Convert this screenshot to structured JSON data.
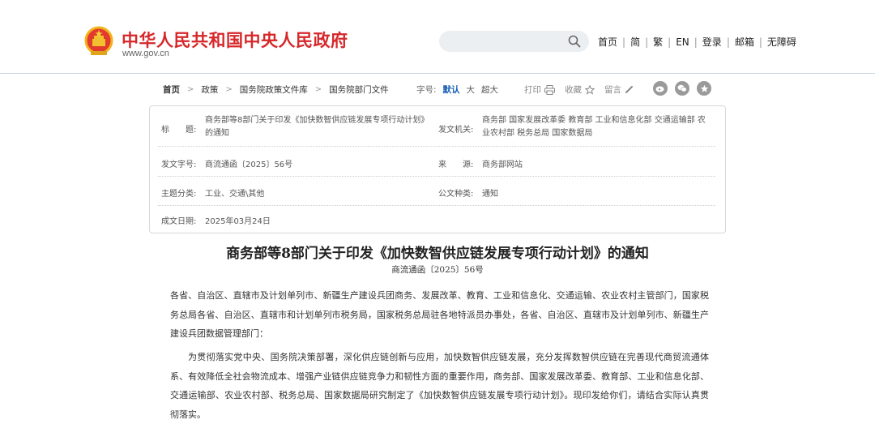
{
  "header": {
    "site_title": "中华人民共和国中央人民政府",
    "site_url": "www.gov.cn",
    "emblem_icon": "national-emblem-icon",
    "search": {
      "placeholder": "",
      "icon": "search-icon"
    },
    "links": [
      "首页",
      "简",
      "繁",
      "EN",
      "登录",
      "邮箱",
      "无障碍"
    ]
  },
  "breadcrumb": [
    "首页",
    "政策",
    "国务院政策文件库",
    "国务院部门文件"
  ],
  "font_size": {
    "label": "字号:",
    "options": [
      "默认",
      "大",
      "超大"
    ],
    "selected": "默认"
  },
  "tools": {
    "print": "打印",
    "favorite": "收藏",
    "comment": "留言"
  },
  "share_icons": [
    "weibo-icon",
    "wechat-icon",
    "star-icon"
  ],
  "meta": {
    "title_label": "标　　题:",
    "title_value": "商务部等8部门关于印发《加快数智供应链发展专项行动计划》的通知",
    "issuer_label": "发文机关:",
    "issuer_value": "商务部 国家发展改革委 教育部 工业和信息化部 交通运输部 农业农村部 税务总局 国家数据局",
    "docno_label": "发文字号:",
    "docno_value": "商流通函〔2025〕56号",
    "source_label": "来　　源:",
    "source_value": "商务部网站",
    "topic_label": "主题分类:",
    "topic_value": "工业、交通\\其他",
    "type_label": "公文种类:",
    "type_value": "通知",
    "date_label": "成文日期:",
    "date_value": "2025年03月24日"
  },
  "article": {
    "title": "商务部等8部门关于印发《加快数智供应链发展专项行动计划》的通知",
    "doc_no": "商流通函〔2025〕56号",
    "addressees": "各省、自治区、直辖市及计划单列市、新疆生产建设兵团商务、发展改革、教育、工业和信息化、交通运输、农业农村主管部门，国家税务总局各省、自治区、直辖市和计划单列市税务局，国家税务总局驻各地特派员办事处，各省、自治区、直辖市及计划单列市、新疆生产建设兵团数据管理部门：",
    "body": "为贯彻落实党中央、国务院决策部署，深化供应链创新与应用，加快数智供应链发展，充分发挥数智供应链在完善现代商贸流通体系、有效降低全社会物流成本、增强产业链供应链竞争力和韧性方面的重要作用，商务部、国家发展改革委、教育部、工业和信息化部、交通运输部、农业农村部、税务总局、国家数据局研究制定了《加快数智供应链发展专项行动计划》。现印发给你们，请结合实际认真贯彻落实。"
  },
  "colors": {
    "brand_red": "#d6272a",
    "link_blue": "#1a5fb4",
    "rule_blue": "#c9d6e6"
  }
}
